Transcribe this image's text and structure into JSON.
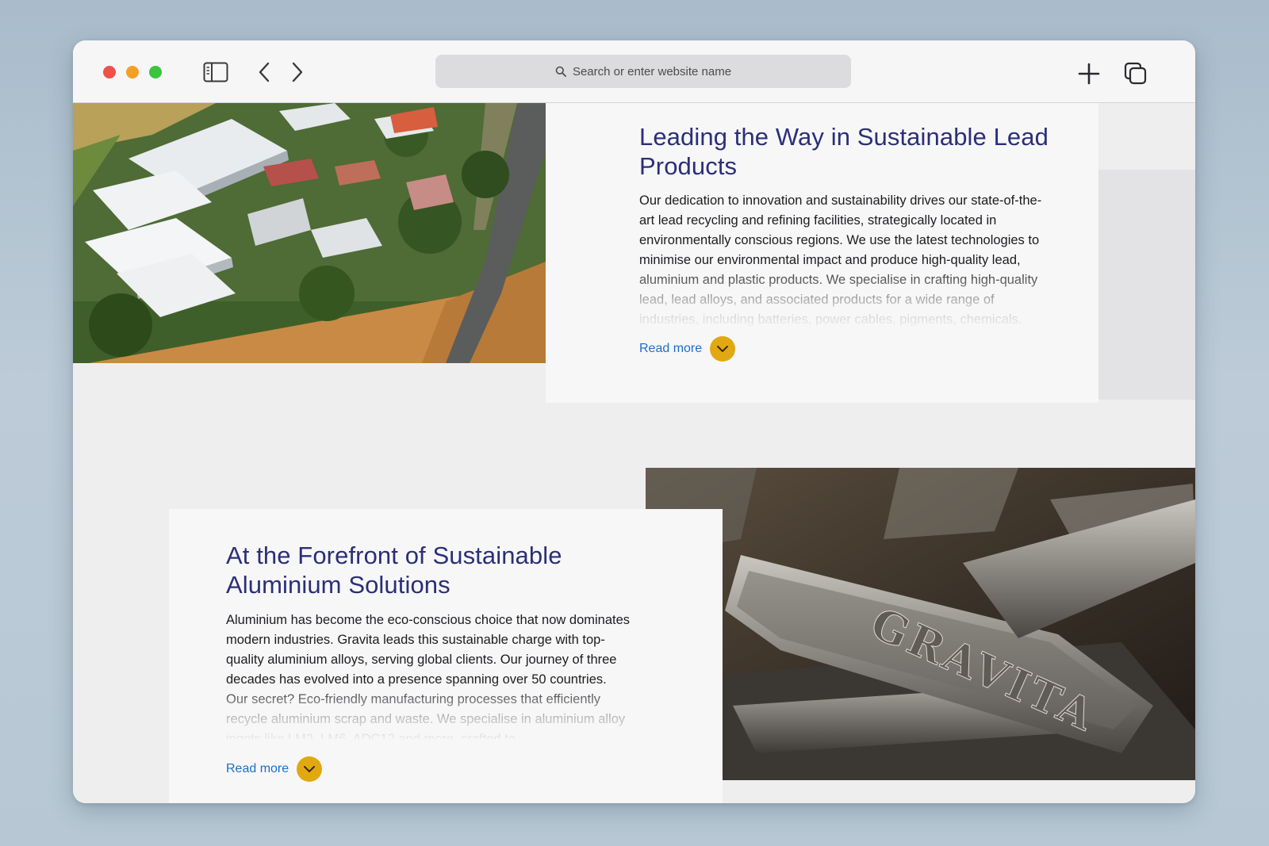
{
  "browser": {
    "search_placeholder": "Search or enter website name"
  },
  "sections": [
    {
      "title": "Leading the Way in Sustainable Lead Products",
      "body": "Our dedication to innovation and sustainability drives our state-of-the-art lead recycling and refining facilities, strategically located in environmentally conscious regions. We use the latest technologies to minimise our environmental impact and produce high-quality lead, aluminium and plastic products. We specialise in crafting high-quality lead, lead alloys, and associated products for a wide range of industries, including batteries, power cables, pigments, chemicals.",
      "read_more": "Read more",
      "image_alt": "Aerial view of industrial facility"
    },
    {
      "title": "At the Forefront of Sustainable Aluminium Solutions",
      "body": "Aluminium has become the eco-conscious choice that now dominates modern industries. Gravita leads this sustainable charge with top-quality aluminium alloys, serving global clients. Our journey of three decades has evolved into a presence spanning over 50 countries. Our secret? Eco-friendly manufacturing processes that efficiently recycle aluminium scrap and waste. We specialise in aluminium alloy ingots like LM2, LM6, ADC12 and more, crafted to",
      "read_more": "Read more",
      "image_alt": "Stacked metal ingots",
      "ingot_mark": "GRAVITA"
    }
  ],
  "colors": {
    "heading": "#2b2f77",
    "link": "#1c6fc6",
    "accent": "#e2a812"
  }
}
